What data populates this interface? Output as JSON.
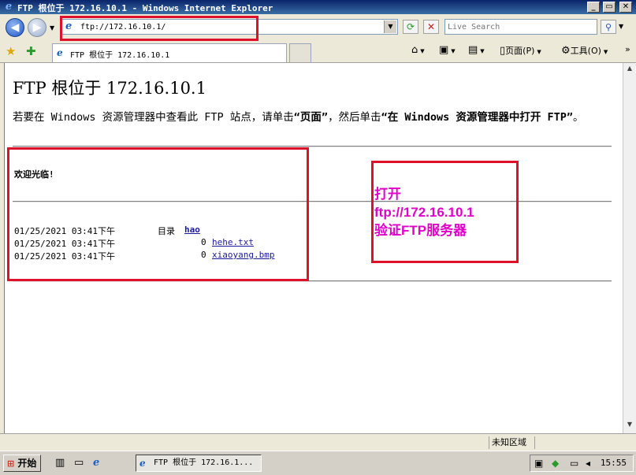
{
  "window": {
    "title": "FTP 根位于 172.16.10.1 - Windows Internet Explorer"
  },
  "address_bar": {
    "value": "ftp://172.16.10.1/"
  },
  "search": {
    "placeholder": "Live Search"
  },
  "tab": {
    "label": "FTP 根位于 172.16.10.1"
  },
  "toolbar": {
    "page_label": "页面(P)",
    "tools_label": "工具(O)"
  },
  "page": {
    "title": "FTP 根位于 172.16.10.1",
    "instruction_prefix": "若要在 Windows 资源管理器中查看此 FTP 站点，请单击",
    "instruction_page": "“页面”",
    "instruction_mid": "，然后单击",
    "instruction_open": "“在 Windows 资源管理器中打开 FTP”",
    "instruction_suffix": "。",
    "welcome": "欢迎光临!",
    "listing": [
      {
        "date": "01/25/2021 03:41下午",
        "type": "目录",
        "size": "",
        "name": "hao"
      },
      {
        "date": "01/25/2021 03:41下午",
        "type": "",
        "size": "0",
        "name": "hehe.txt"
      },
      {
        "date": "01/25/2021 03:41下午",
        "type": "",
        "size": "0",
        "name": "xiaoyang.bmp"
      }
    ]
  },
  "annotation": {
    "line1": "打开",
    "line2": "ftp://172.16.10.1",
    "line3": "验证FTP服务器",
    "color": "#e000c8",
    "box_color": "#e0102a"
  },
  "status_bar": {
    "zone": "未知区域"
  },
  "taskbar": {
    "start_label": "开始",
    "task_label": "FTP 根位于 172.16.1...",
    "clock": "15:55"
  }
}
